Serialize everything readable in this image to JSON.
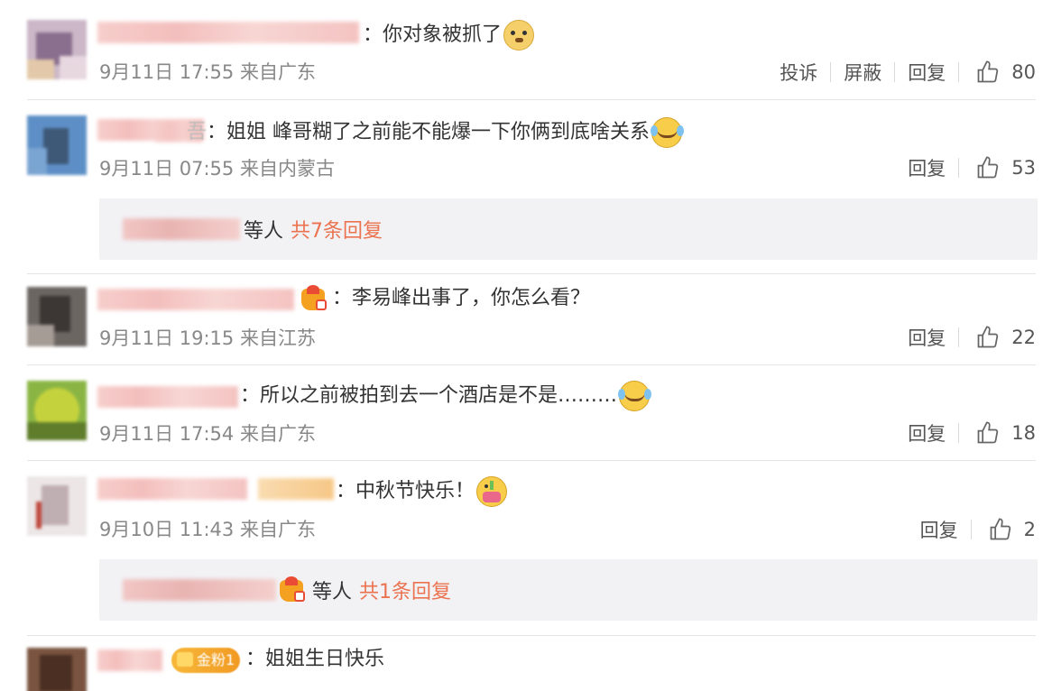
{
  "labels": {
    "report": "投诉",
    "block": "屏蔽",
    "reply": "回复"
  },
  "comments": [
    {
      "text": "：你对象被抓了",
      "time": "9月11日 17:55 来自广东",
      "likes": "80"
    },
    {
      "text": "：姐姐 峰哥糊了之前能不能爆一下你俩到底啥关系",
      "name_suffix": "吾",
      "time": "9月11日 07:55 来自内蒙古",
      "likes": "53",
      "reply": {
        "who": "等人",
        "count": "共7条回复"
      }
    },
    {
      "text": "：李易峰出事了，你怎么看？",
      "time": "9月11日 19:15 来自江苏",
      "likes": "22"
    },
    {
      "text": "：所以之前被拍到去一个酒店是不是………",
      "time": "9月11日 17:54 来自广东",
      "likes": "18"
    },
    {
      "text": "：中秋节快乐！",
      "time": "9月10日 11:43 来自广东",
      "likes": "2",
      "reply": {
        "who": "等人",
        "count": "共1条回复"
      }
    },
    {
      "text": "：姐姐生日快乐",
      "badge": "金粉1"
    }
  ]
}
